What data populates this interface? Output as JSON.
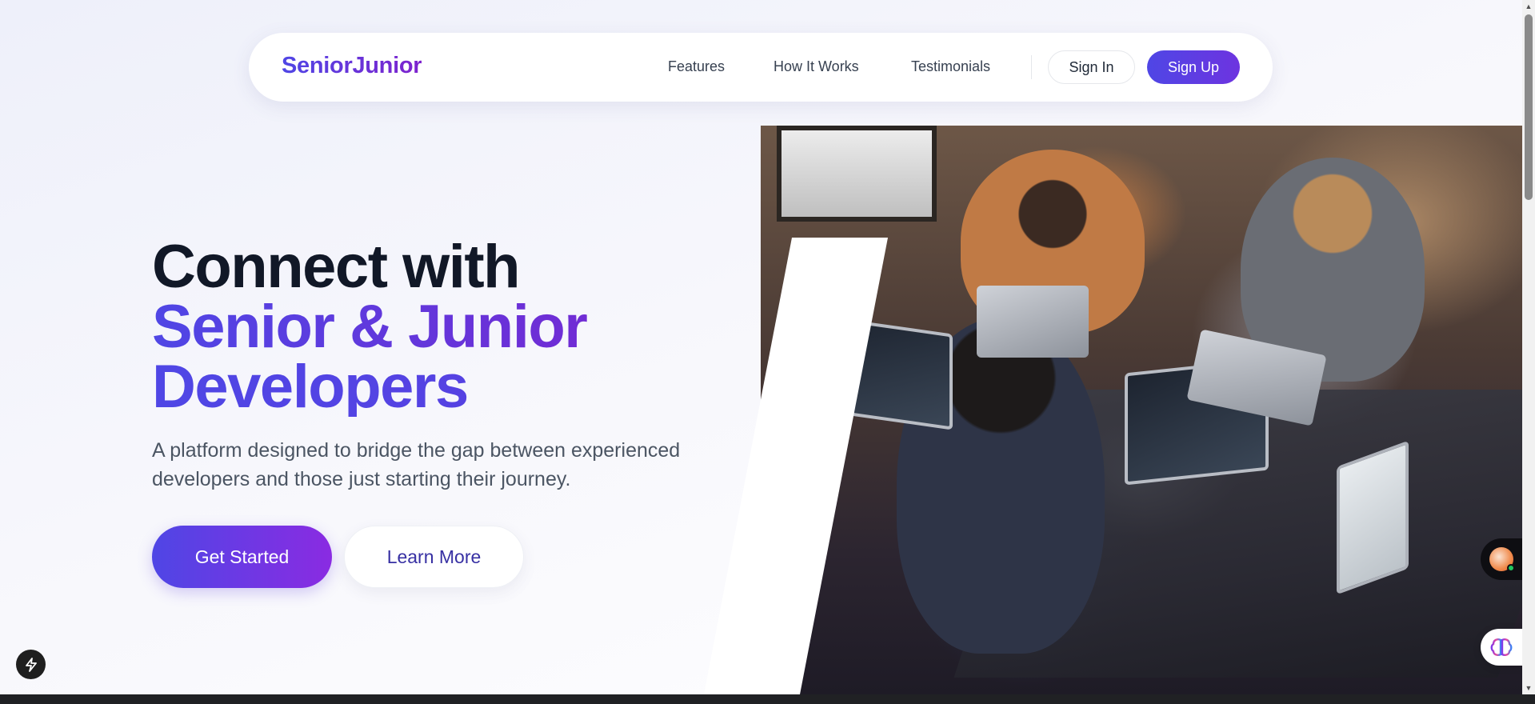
{
  "nav": {
    "brand": "SeniorJunior",
    "links": [
      {
        "label": "Features"
      },
      {
        "label": "How It Works"
      },
      {
        "label": "Testimonials"
      }
    ],
    "sign_in": "Sign In",
    "sign_up": "Sign Up"
  },
  "hero": {
    "heading_line1": "Connect with",
    "heading_line2": "Senior & Junior",
    "heading_line3": "Developers",
    "subtitle": "A platform designed to bridge the gap between experienced developers and those just starting their journey.",
    "primary_cta": "Get Started",
    "secondary_cta": "Learn More",
    "image_icon": "team-coding-photo"
  },
  "widgets": {
    "bolt_icon": "bolt-icon",
    "chat_icon": "chat-avatar-icon",
    "brain_icon": "brain-icon"
  },
  "colors": {
    "brand_gradient_start": "#4f46e5",
    "brand_gradient_end": "#7e22ce",
    "heading_dark": "#111827",
    "body_text": "#4b5563"
  }
}
